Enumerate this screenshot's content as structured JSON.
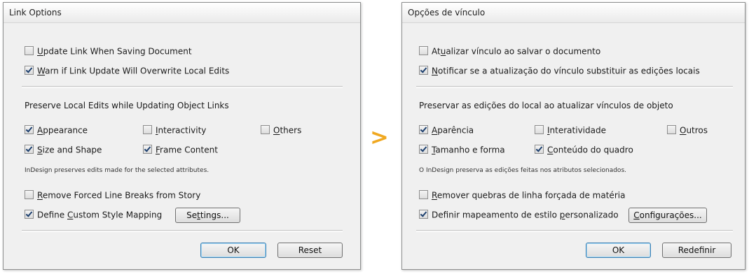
{
  "arrow": ">",
  "left": {
    "title": "Link Options",
    "update_link": {
      "pre": "",
      "m": "U",
      "post": "pdate Link When Saving Document",
      "checked": false
    },
    "warn_overwrite": {
      "pre": "",
      "m": "W",
      "post": "arn if Link Update Will Overwrite Local Edits",
      "checked": true
    },
    "preserve_heading": "Preserve Local Edits while Updating Object Links",
    "appearance": {
      "pre": "",
      "m": "A",
      "post": "ppearance",
      "checked": true
    },
    "interactivity": {
      "pre": "",
      "m": "I",
      "post": "nteractivity",
      "checked": false
    },
    "others": {
      "pre": "",
      "m": "O",
      "post": "thers",
      "checked": false
    },
    "size_shape": {
      "pre": "",
      "m": "S",
      "post": "ize and Shape",
      "checked": true
    },
    "frame_content": {
      "pre": "",
      "m": "F",
      "post": "rame Content",
      "checked": true
    },
    "note": "InDesign preserves edits made for the selected attributes.",
    "remove_breaks": {
      "pre": "",
      "m": "R",
      "post": "emove Forced Line Breaks from Story",
      "checked": false
    },
    "custom_mapping": {
      "pre": "Define ",
      "m": "C",
      "post": "ustom Style Mapping",
      "checked": true
    },
    "settings": {
      "pre": "Se",
      "m": "t",
      "post": "tings..."
    },
    "ok": "OK",
    "reset": "Reset"
  },
  "right": {
    "title": "Opções de vínculo",
    "update_link": {
      "pre": "At",
      "m": "u",
      "post": "alizar vínculo ao salvar o documento",
      "checked": false
    },
    "warn_overwrite": {
      "pre": "",
      "m": "N",
      "post": "otificar se a atualização do vínculo substituir as edições locais",
      "checked": true
    },
    "preserve_heading": "Preservar as edições do local ao atualizar vínculos de objeto",
    "appearance": {
      "pre": "",
      "m": "A",
      "post": "parência",
      "checked": true
    },
    "interactivity": {
      "pre": "",
      "m": "I",
      "post": "nteratividade",
      "checked": false
    },
    "others": {
      "pre": "",
      "m": "O",
      "post": "utros",
      "checked": false
    },
    "size_shape": {
      "pre": "",
      "m": "T",
      "post": "amanho e forma",
      "checked": true
    },
    "frame_content": {
      "pre": "",
      "m": "C",
      "post": "onteúdo do quadro",
      "checked": true
    },
    "note": "O InDesign preserva as edições feitas nos atributos selecionados.",
    "remove_breaks": {
      "pre": "",
      "m": "R",
      "post": "emover quebras de linha forçada de matéria",
      "checked": false
    },
    "custom_mapping": {
      "pre": "Definir mapeamento de estilo ",
      "m": "p",
      "post": "ersonalizado",
      "checked": true
    },
    "settings": {
      "pre": "",
      "m": "C",
      "post": "onfigurações..."
    },
    "ok": "OK",
    "reset": "Redefinir"
  }
}
